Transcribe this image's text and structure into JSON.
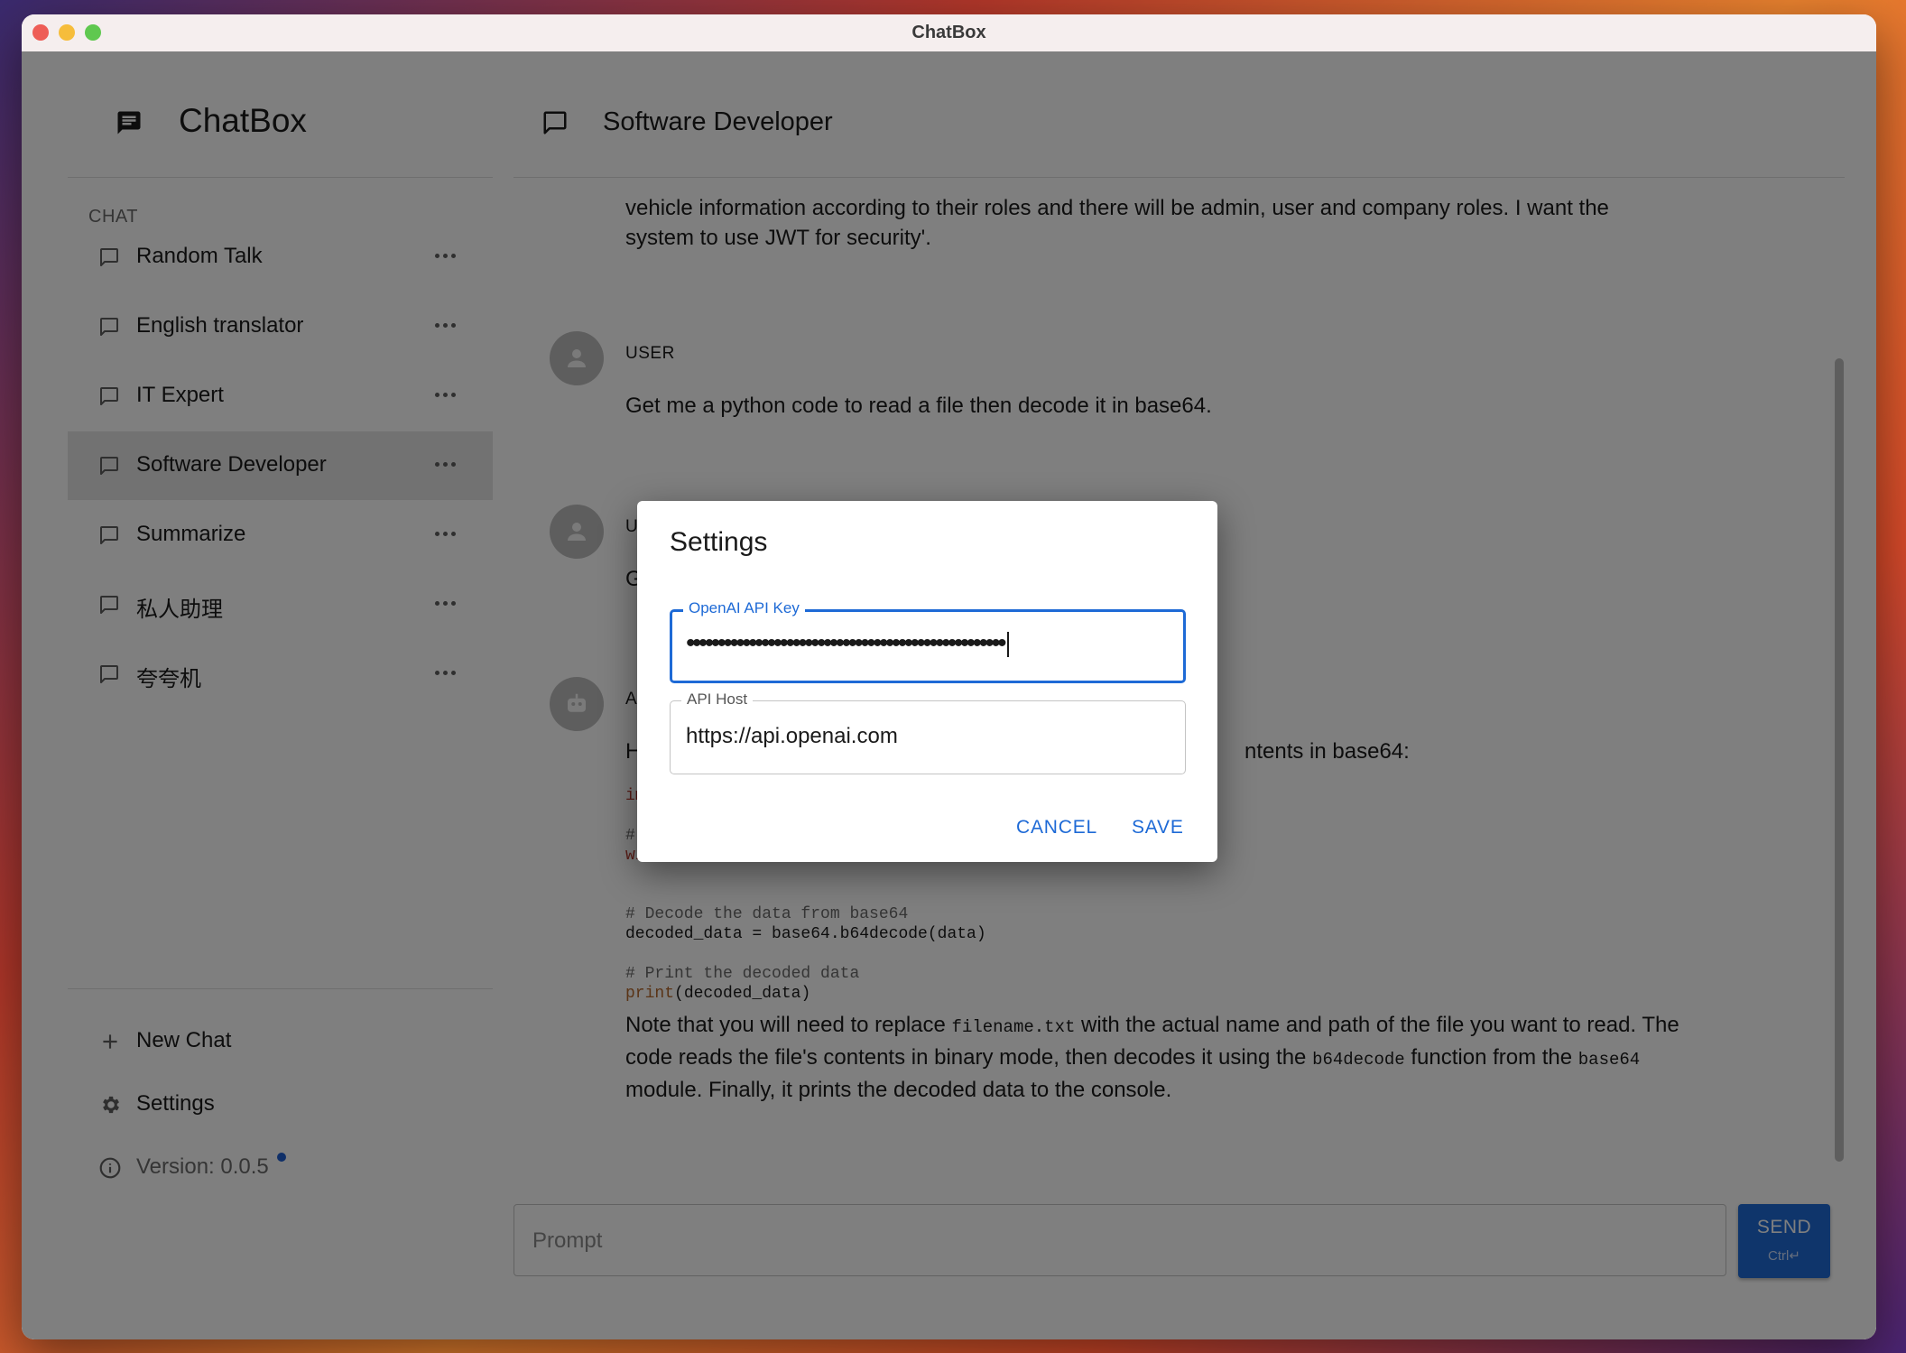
{
  "window": {
    "title": "ChatBox"
  },
  "sidebar": {
    "brand": "ChatBox",
    "section_label": "CHAT",
    "items": [
      {
        "label": "Random Talk"
      },
      {
        "label": "English translator"
      },
      {
        "label": "IT Expert"
      },
      {
        "label": "Software Developer",
        "active": true
      },
      {
        "label": "Summarize"
      },
      {
        "label": "私人助理"
      },
      {
        "label": "夸夸机"
      }
    ],
    "new_chat": "New Chat",
    "settings": "Settings",
    "version": "Version: 0.0.5"
  },
  "main": {
    "title": "Software Developer",
    "messages": [
      {
        "text": "vehicle information according to their roles and there will be admin, user and company roles. I want the system to use JWT for security'."
      },
      {
        "role": "USER",
        "text": "Get me a python code to read a file then decode it in base64."
      },
      {
        "role": "USER",
        "text": "Get"
      },
      {
        "role": "ASS",
        "intro_start": "Her",
        "intro_end": "ntents in base64:",
        "code_frag_1": "impo",
        "code_frag_2": "# Op",
        "code_frag_3": "with",
        "code_comment_1": "# Decode the data from base64",
        "code_line_1": "decoded_data = base64.b64decode(data)",
        "code_comment_2": "# Print the decoded data",
        "code_fn": "print",
        "code_args": "(decoded_data)",
        "note_1": "Note that you will need to replace ",
        "note_code_1": "filename.txt",
        "note_2": " with the actual name and path of the file you want to read. The code reads the file's contents in binary mode, then decodes it using the ",
        "note_code_2": "b64decode",
        "note_3": " function from the ",
        "note_code_3": "base64",
        "note_4": " module. Finally, it prints the decoded data to the console."
      }
    ],
    "prompt_placeholder": "Prompt",
    "send_label": "SEND",
    "send_hint": "Ctrl↵"
  },
  "dialog": {
    "title": "Settings",
    "api_key_label": "OpenAI API Key",
    "api_key_value": "•••••••••••••••••••••••••••••••••••••••••••••••••••",
    "api_host_label": "API Host",
    "api_host_value": "https://api.openai.com",
    "cancel": "CANCEL",
    "save": "SAVE"
  },
  "colors": {
    "accent": "#1e6ad6",
    "traffic_close": "#ee5d56",
    "traffic_min": "#f6bd3b",
    "traffic_max": "#5fc84f",
    "backdrop": "rgba(0,0,0,0.5)"
  },
  "icons": [
    "chat-bubble-filled-icon",
    "chat-bubble-outline-icon",
    "more-horiz-icon",
    "plus-icon",
    "gear-icon",
    "info-icon",
    "user-avatar-icon",
    "robot-avatar-icon"
  ]
}
